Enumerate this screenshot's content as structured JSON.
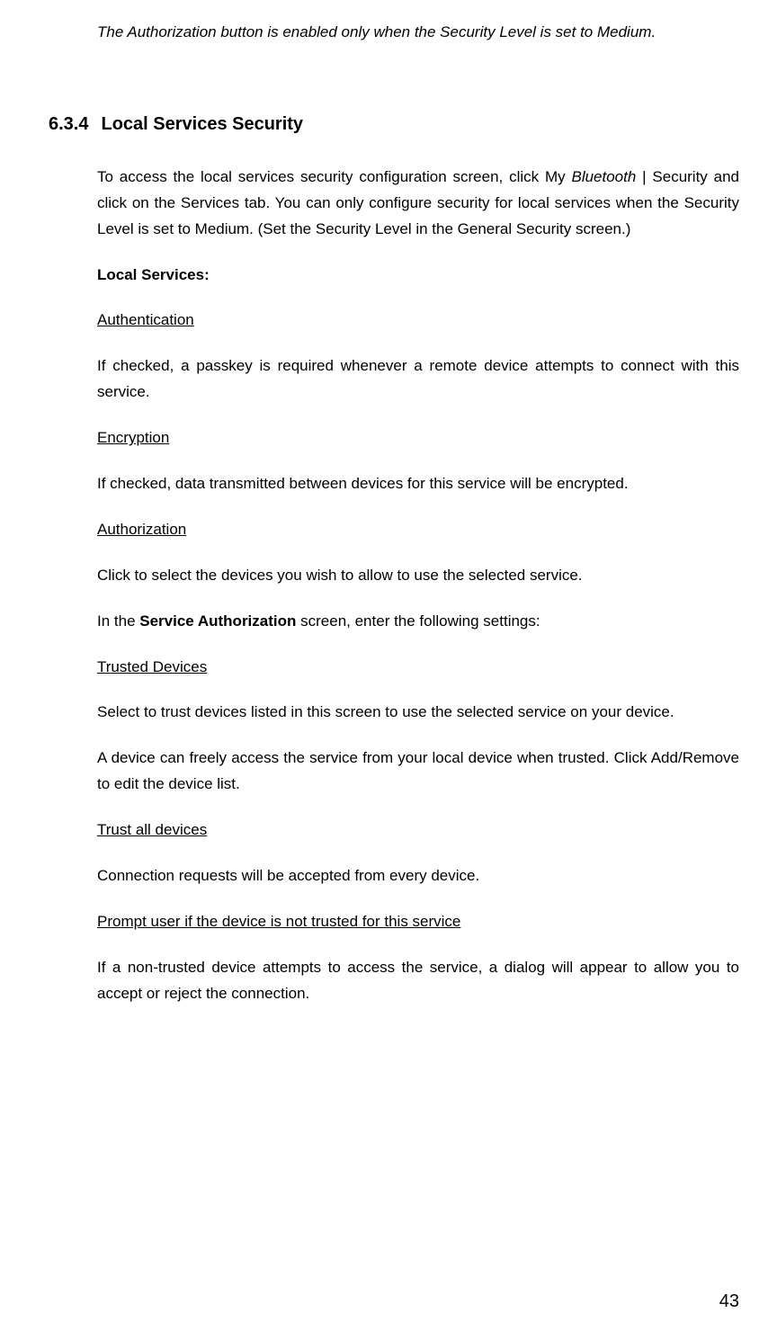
{
  "intro_note": "The Authorization button is enabled only when the Security Level is set to Medium.",
  "section": {
    "number": "6.3.4",
    "title": "Local Services Security"
  },
  "para_access_1": "To access the local services security configuration screen, click My ",
  "para_access_italic": "Bluetooth",
  "para_access_2": " | Security and click on the Services tab. You can only configure security for local services when the Security Level is set to Medium. (Set the Security Level in the General Security screen.)",
  "local_services_label": "Local Services:",
  "authentication": {
    "heading": "Authentication",
    "body": "If checked, a passkey is required whenever a remote device attempts to connect with this service."
  },
  "encryption": {
    "heading": "Encryption",
    "body": "If checked, data transmitted between devices for this service will be encrypted."
  },
  "authorization": {
    "heading": "Authorization",
    "body": "Click to select the devices you wish to allow to use the selected service."
  },
  "service_auth_1": "In the ",
  "service_auth_bold": "Service Authorization",
  "service_auth_2": " screen, enter the following settings:",
  "trusted_devices": {
    "heading": "Trusted Devices",
    "body1": "Select to trust devices listed in this screen to use the selected service on your device.",
    "body2": "A device can freely access the service from your local device when trusted. Click Add/Remove to edit the device list."
  },
  "trust_all": {
    "heading": "Trust all devices",
    "body": "Connection requests will be accepted from every device."
  },
  "prompt": {
    "heading": "Prompt user if the device is not trusted for this service",
    "body": "If a non-trusted device attempts to access the service, a dialog will appear to allow you to accept or reject the connection."
  },
  "page_number": "43"
}
